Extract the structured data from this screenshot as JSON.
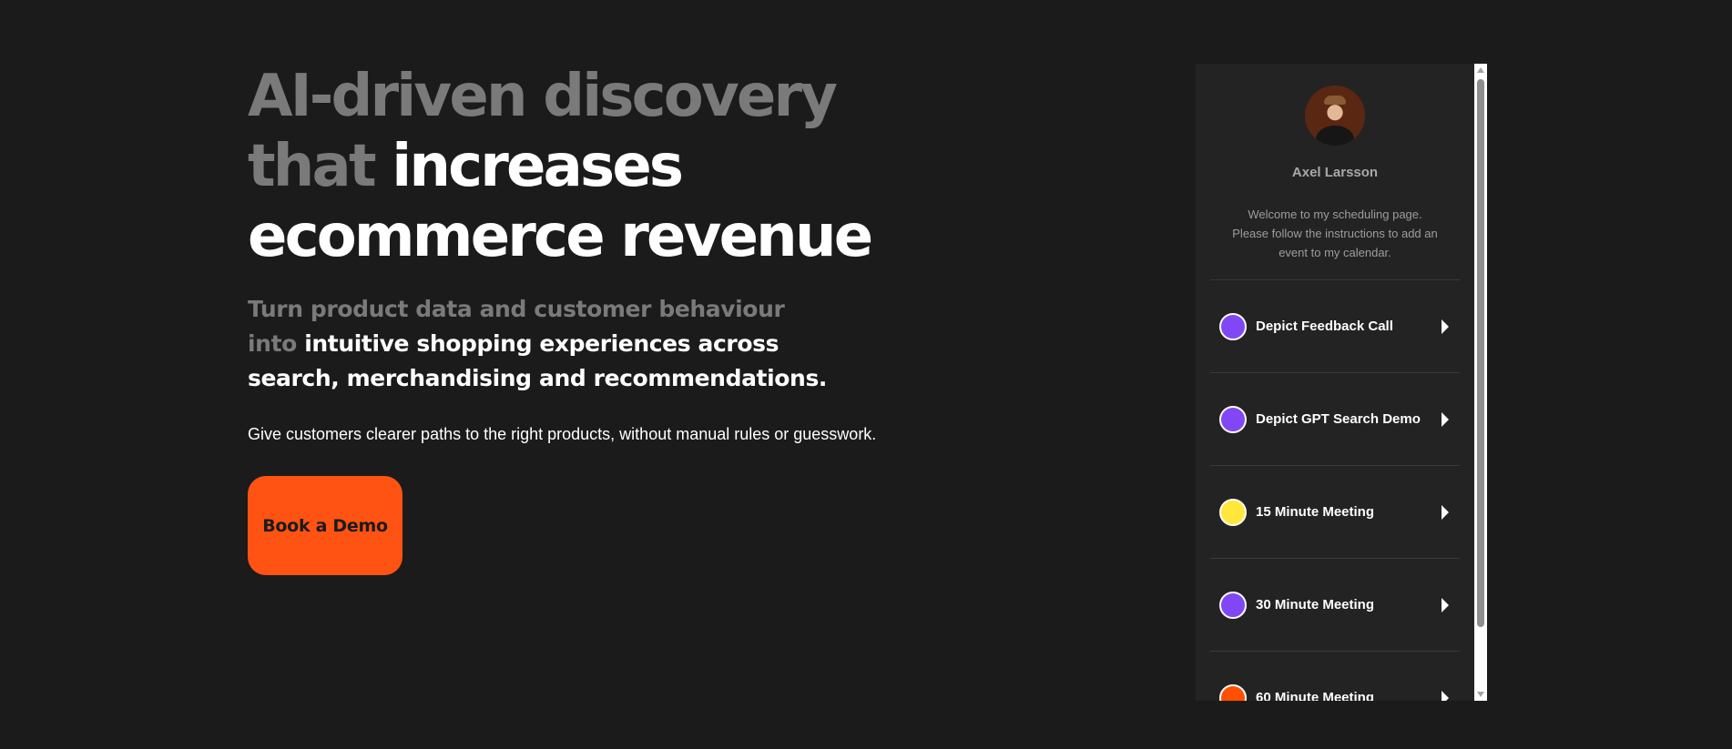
{
  "hero": {
    "headline_muted": "AI-driven discovery that ",
    "headline_bright": "increases ecommerce revenue",
    "subhead_muted": "Turn product data and customer behaviour into ",
    "subhead_bright": "intuitive shopping experiences across search, merchandising and recommendations.",
    "lead": "Give customers clearer paths to the right products, without manual rules or guesswork.",
    "cta_label": "Book a Demo"
  },
  "scheduler": {
    "owner_name": "Axel Larsson",
    "welcome": "Welcome to my scheduling page. Please follow the instructions to add an event to my calendar.",
    "events": [
      {
        "label": "Depict Feedback Call",
        "color": "#8247f5"
      },
      {
        "label": "Depict GPT Search Demo",
        "color": "#8247f5"
      },
      {
        "label": "15 Minute Meeting",
        "color": "#ffe73b"
      },
      {
        "label": "30 Minute Meeting",
        "color": "#8247f5"
      },
      {
        "label": "60 Minute Meeting",
        "color": "#ff4f00"
      }
    ]
  },
  "colors": {
    "background": "#1b1b1b",
    "muted_text": "#7a7a7a",
    "accent": "#ff5313",
    "widget_bg": "#232323"
  }
}
